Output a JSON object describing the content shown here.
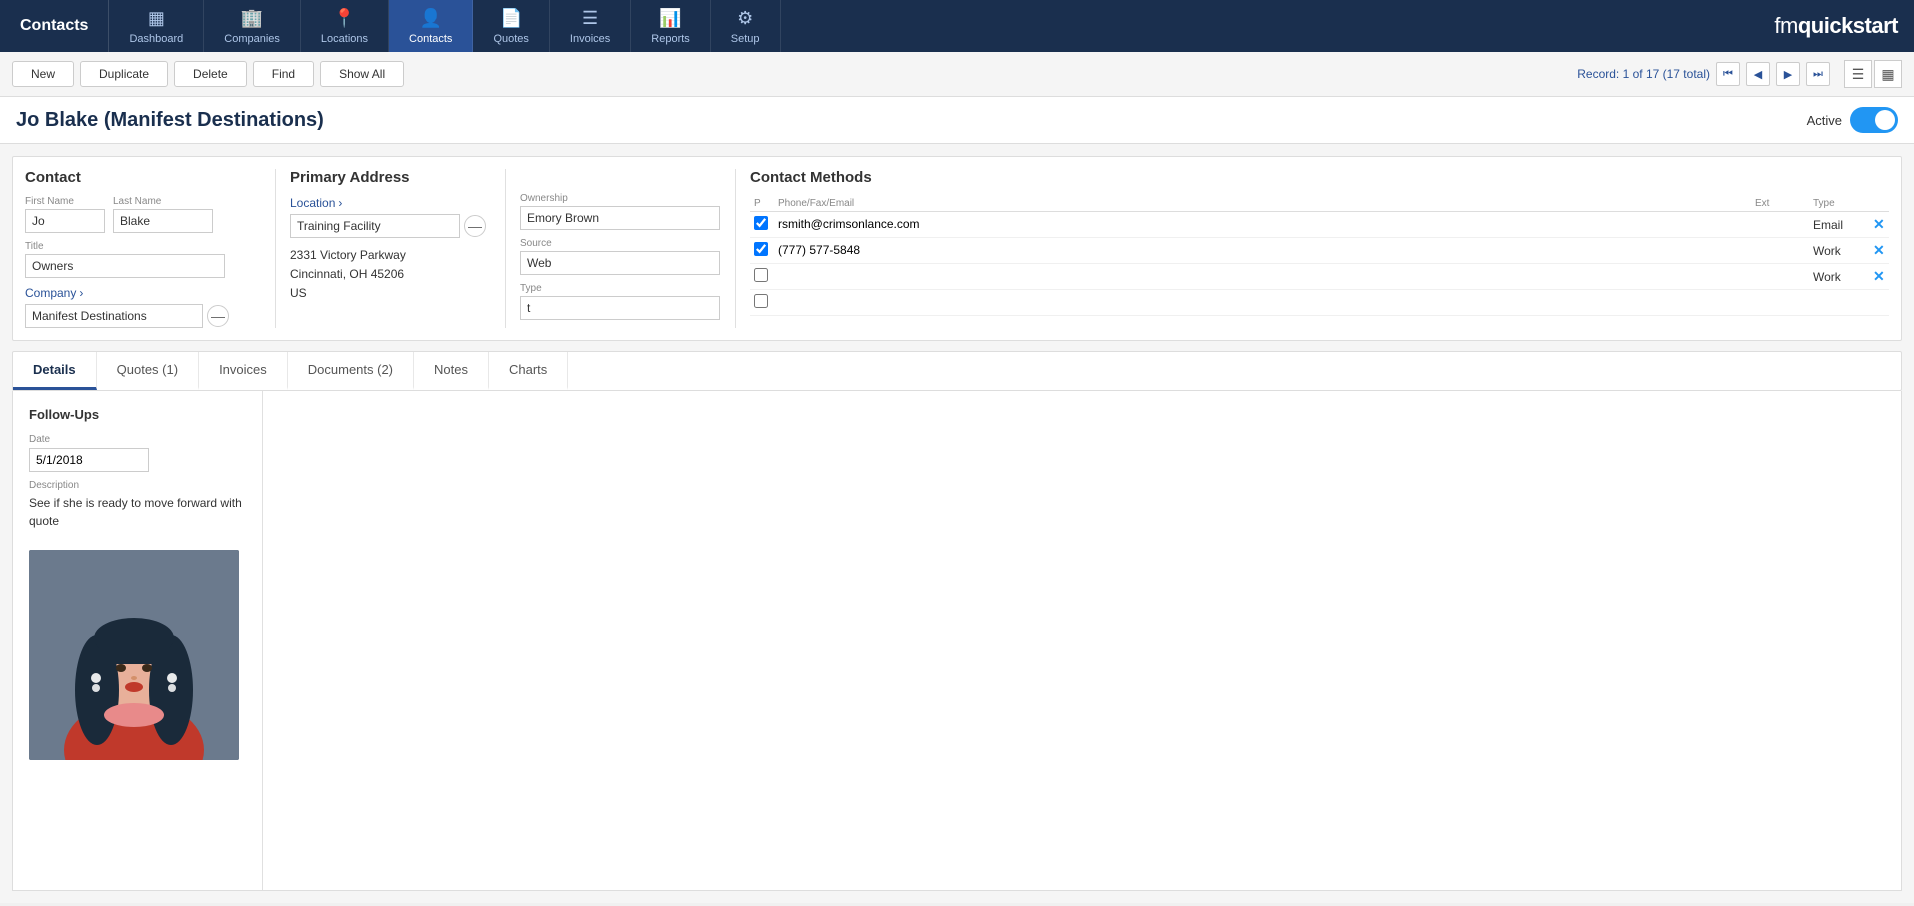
{
  "app": {
    "title": "Contacts",
    "brand": "fmquickstart"
  },
  "nav": {
    "items": [
      {
        "id": "dashboard",
        "label": "Dashboard",
        "icon": "▦",
        "active": false
      },
      {
        "id": "companies",
        "label": "Companies",
        "icon": "🏢",
        "active": false
      },
      {
        "id": "locations",
        "label": "Locations",
        "icon": "📍",
        "active": false
      },
      {
        "id": "contacts",
        "label": "Contacts",
        "icon": "👤",
        "active": true
      },
      {
        "id": "quotes",
        "label": "Quotes",
        "icon": "📄",
        "active": false
      },
      {
        "id": "invoices",
        "label": "Invoices",
        "icon": "☰",
        "active": false
      },
      {
        "id": "reports",
        "label": "Reports",
        "icon": "📊",
        "active": false
      },
      {
        "id": "setup",
        "label": "Setup",
        "icon": "⚙",
        "active": false
      }
    ]
  },
  "toolbar": {
    "new_label": "New",
    "duplicate_label": "Duplicate",
    "delete_label": "Delete",
    "find_label": "Find",
    "show_all_label": "Show All",
    "record_info": "Record:  1 of 17 (17 total)"
  },
  "record": {
    "title": "Jo Blake (Manifest Destinations)",
    "active_label": "Active",
    "active": true
  },
  "contact": {
    "panel_title": "Contact",
    "first_name_label": "First Name",
    "first_name": "Jo",
    "last_name_label": "Last Name",
    "last_name": "Blake",
    "title_label": "Title",
    "title_value": "Owners",
    "company_label": "Company",
    "company_value": "Manifest Destinations"
  },
  "primary_address": {
    "panel_title": "Primary Address",
    "location_label": "Location",
    "location_value": "Training Facility",
    "address_line1": "2331 Victory Parkway",
    "address_line2": "Cincinnati, OH 45206",
    "address_line3": "US"
  },
  "ownership": {
    "ownership_label": "Ownership",
    "ownership_value": "Emory Brown",
    "source_label": "Source",
    "source_value": "Web",
    "type_label": "Type",
    "type_value": "t"
  },
  "contact_methods": {
    "panel_title": "Contact Methods",
    "col_p": "P",
    "col_phone_fax_email": "Phone/Fax/Email",
    "col_ext": "Ext",
    "col_type": "Type",
    "rows": [
      {
        "checked": true,
        "value": "rsmith@crimsonlance.com",
        "ext": "",
        "type": "Email"
      },
      {
        "checked": true,
        "value": "(777) 577-5848",
        "ext": "",
        "type": "Work"
      },
      {
        "checked": false,
        "value": "",
        "ext": "",
        "type": "Work"
      },
      {
        "checked": false,
        "value": "",
        "ext": "",
        "type": ""
      }
    ]
  },
  "tabs": {
    "items": [
      {
        "id": "details",
        "label": "Details",
        "active": true
      },
      {
        "id": "quotes",
        "label": "Quotes (1)",
        "active": false
      },
      {
        "id": "invoices",
        "label": "Invoices",
        "active": false
      },
      {
        "id": "documents",
        "label": "Documents (2)",
        "active": false
      },
      {
        "id": "notes",
        "label": "Notes",
        "active": false
      },
      {
        "id": "charts",
        "label": "Charts",
        "active": false
      }
    ]
  },
  "followups": {
    "section_title": "Follow-Ups",
    "date_label": "Date",
    "date_value": "5/1/2018",
    "description_label": "Description",
    "description_value": "See if she is ready to move forward with quote"
  }
}
